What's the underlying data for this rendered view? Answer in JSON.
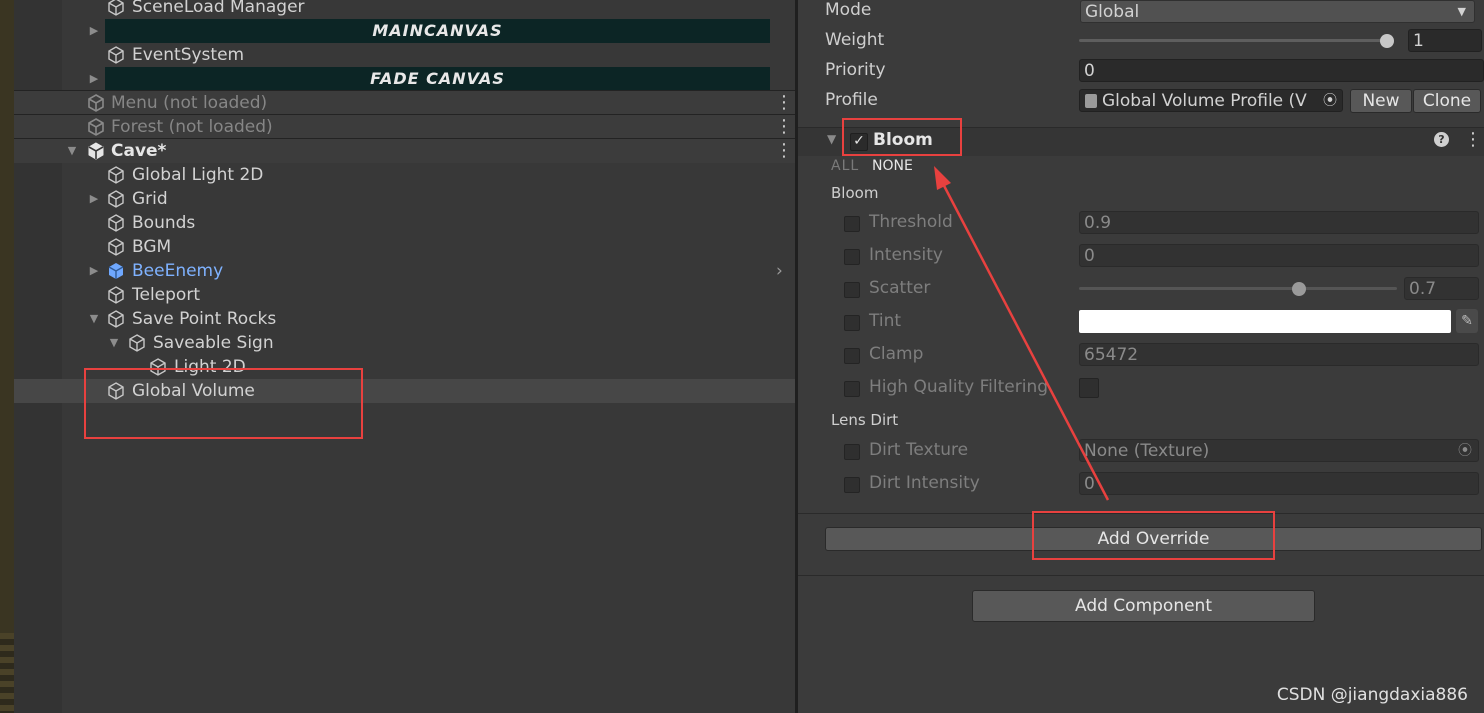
{
  "hierarchy": {
    "rows": [
      {
        "label": "SceneLoad Manager"
      },
      {
        "label": "MAINCANVAS"
      },
      {
        "label": "EventSystem"
      },
      {
        "label": "FADE CANVAS"
      },
      {
        "label": "Menu (not loaded)"
      },
      {
        "label": "Forest (not loaded)"
      },
      {
        "label": "Cave*"
      },
      {
        "label": "Global Light 2D"
      },
      {
        "label": "Grid"
      },
      {
        "label": "Bounds"
      },
      {
        "label": "BGM"
      },
      {
        "label": "BeeEnemy"
      },
      {
        "label": "Teleport"
      },
      {
        "label": "Save Point Rocks"
      },
      {
        "label": "Saveable Sign"
      },
      {
        "label": "Light 2D"
      },
      {
        "label": "Global Volume"
      }
    ]
  },
  "inspector": {
    "mode_label": "Mode",
    "mode_value": "Global",
    "weight_label": "Weight",
    "weight_value": "1",
    "weight_fraction": 1.0,
    "priority_label": "Priority",
    "priority_value": "0",
    "profile_label": "Profile",
    "profile_value": "Global Volume Profile (V",
    "new_button": "New",
    "clone_button": "Clone",
    "bloom_header": "Bloom",
    "all_link": "ALL",
    "none_link": "NONE",
    "bloom_group": "Bloom",
    "threshold_label": "Threshold",
    "threshold_value": "0.9",
    "intensity_label": "Intensity",
    "intensity_value": "0",
    "scatter_label": "Scatter",
    "scatter_value": "0.7",
    "scatter_fraction": 0.7,
    "tint_label": "Tint",
    "tint_color": "#ffffff",
    "clamp_label": "Clamp",
    "clamp_value": "65472",
    "hq_label": "High Quality Filtering",
    "lens_dirt_group": "Lens Dirt",
    "dirt_texture_label": "Dirt Texture",
    "dirt_texture_value": "None (Texture)",
    "dirt_intensity_label": "Dirt Intensity",
    "dirt_intensity_value": "0",
    "add_override": "Add Override",
    "add_component": "Add Component"
  },
  "watermark": "CSDN @jiangdaxia886",
  "colors": {
    "annotation_red": "#e8413f",
    "prefab_blue": "#7fb2ff"
  }
}
